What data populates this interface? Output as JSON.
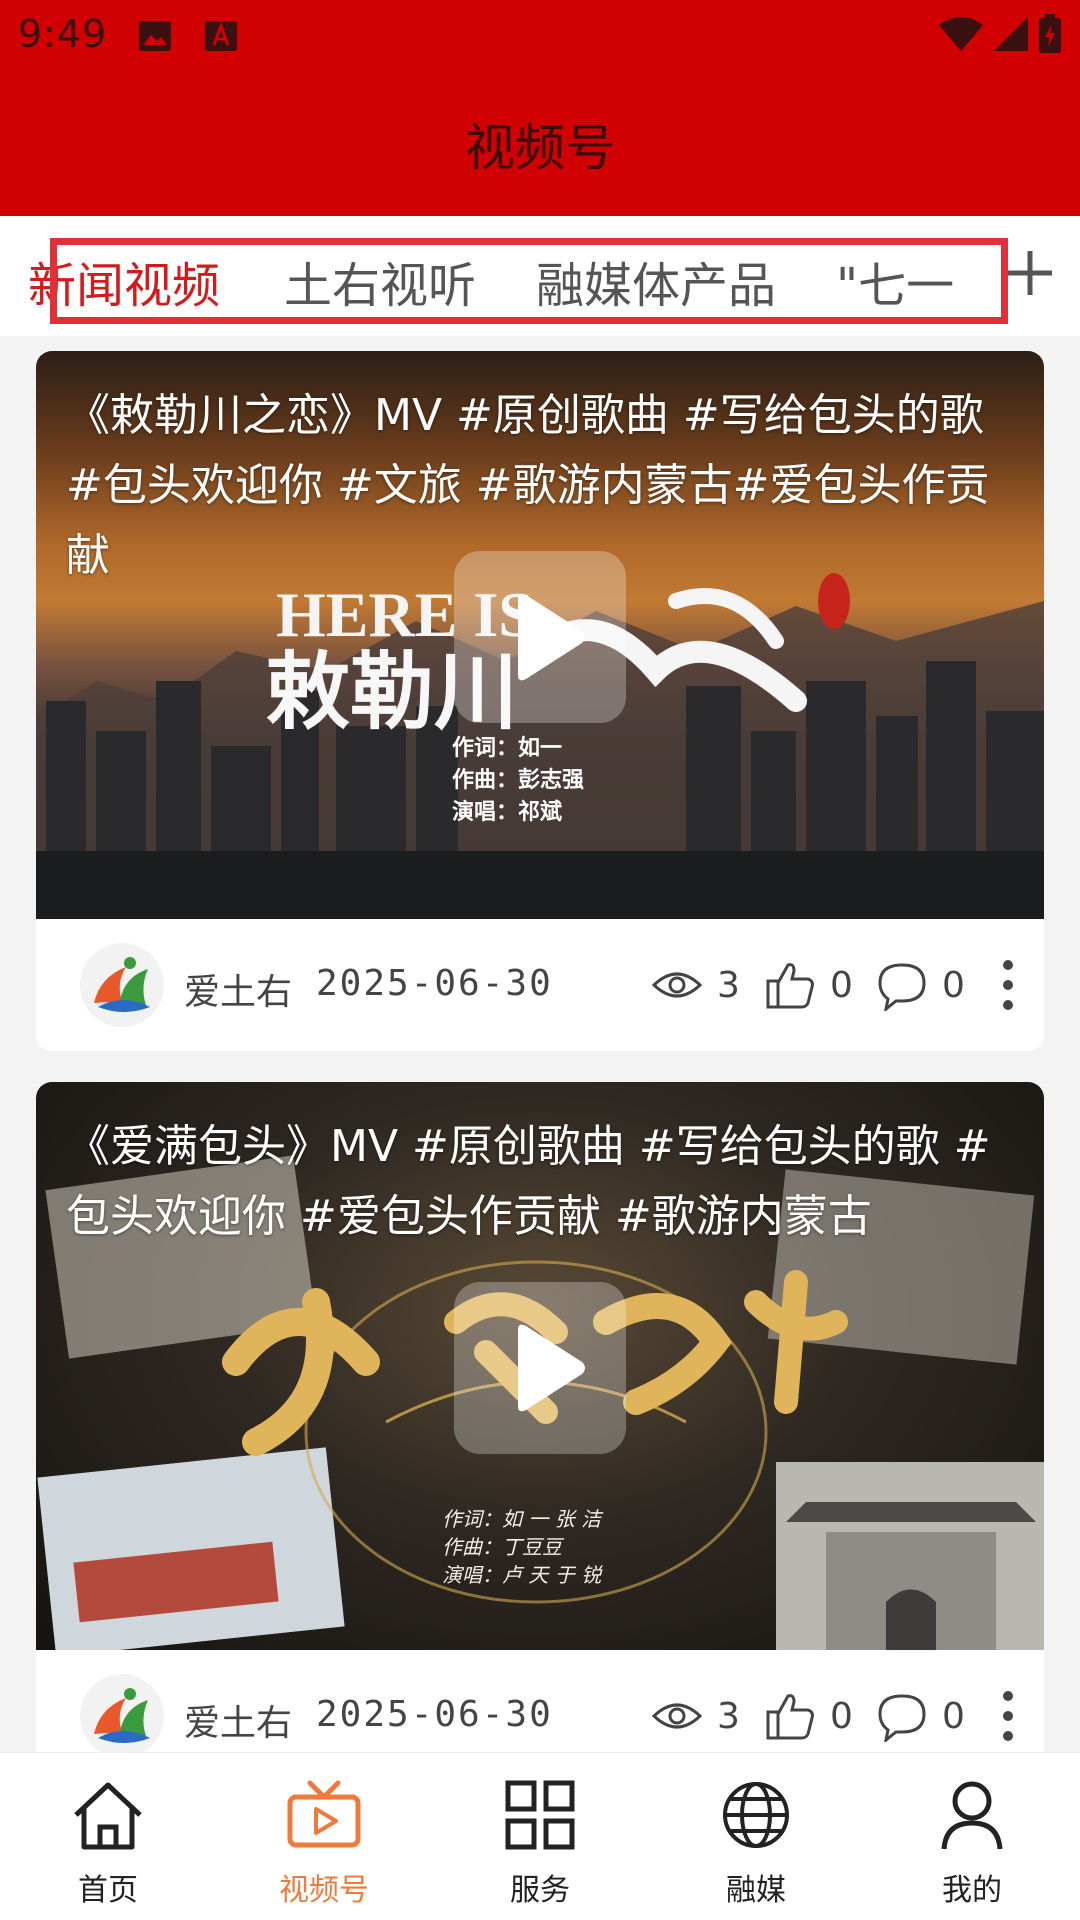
{
  "status_bar": {
    "time": "9:49"
  },
  "header": {
    "title": "视频号"
  },
  "tabs": [
    {
      "label": "新闻视频",
      "active": true
    },
    {
      "label": "土右视听",
      "active": false
    },
    {
      "label": "融媒体产品",
      "active": false
    },
    {
      "label": "\"七一",
      "active": false
    }
  ],
  "videos": [
    {
      "title": "《敕勒川之恋》MV #原创歌曲 #写给包头的歌 #包头欢迎你 #文旅 #歌游内蒙古#爱包头作贡献",
      "author": "爱土右",
      "date": "2025-06-30",
      "views": "3",
      "likes": "0",
      "comments": "0"
    },
    {
      "title": "《爱满包头》MV #原创歌曲 #写给包头的歌 #包头欢迎你 #爱包头作贡献 #歌游内蒙古",
      "author": "爱土右",
      "date": "2025-06-30",
      "views": "3",
      "likes": "0",
      "comments": "0"
    }
  ],
  "bottom_nav": [
    {
      "label": "首页",
      "icon": "home-icon",
      "active": false
    },
    {
      "label": "视频号",
      "icon": "video-tv-icon",
      "active": true
    },
    {
      "label": "服务",
      "icon": "grid-icon",
      "active": false
    },
    {
      "label": "融媒",
      "icon": "globe-icon",
      "active": false
    },
    {
      "label": "我的",
      "icon": "person-icon",
      "active": false
    }
  ],
  "colors": {
    "brand_red": "#d00003",
    "tab_active": "#d31b1b",
    "nav_active": "#f07a3c",
    "highlight_box": "#e0303a"
  }
}
